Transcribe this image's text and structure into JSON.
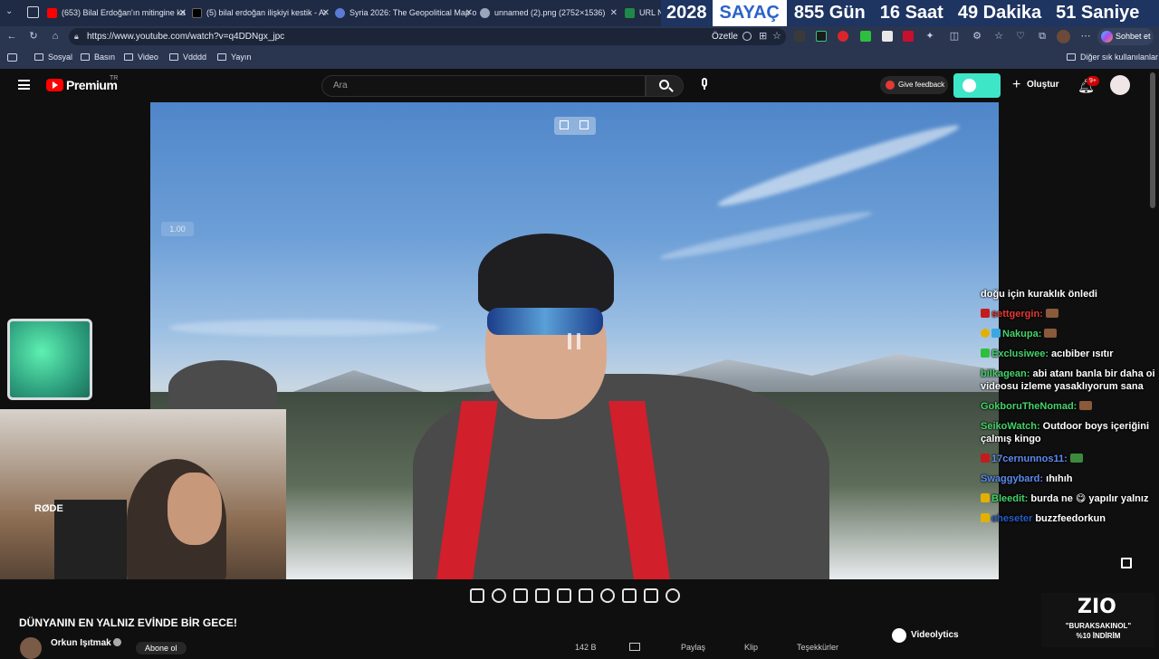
{
  "tabs": [
    {
      "title": "(653) Bilal Erdoğan'ın mitingine ka",
      "favicon_color": "#ff0000"
    },
    {
      "title": "(5) bilal erdoğan ilişkiyi kestik - Ar",
      "favicon_color": "#000000"
    },
    {
      "title": "Syria 2026: The Geopolitical Map o",
      "favicon_color": "#5a7bd6"
    },
    {
      "title": "unnamed (2).png (2752×1536)",
      "favicon_color": "#9aa6bd"
    },
    {
      "title": "URL N",
      "favicon_color": "#1f8a47"
    }
  ],
  "counter": {
    "year": "2028",
    "label": "SAYAÇ",
    "days": "855 Gün",
    "hours": "16 Saat",
    "minutes": "49 Dakika",
    "seconds": "51 Saniye"
  },
  "address": {
    "url": "https://www.youtube.com/watch?v=q4DDNgx_jpc",
    "summarize_label": "Özetle",
    "chat_label": "Sohbet et"
  },
  "bookmarks": {
    "items": [
      "Sosyal",
      "Basın",
      "Video",
      "Vdddd",
      "Yayın"
    ],
    "other": "Diğer sık kullanılanlar"
  },
  "youtube": {
    "logo": "Premium",
    "region": "TR",
    "search_placeholder": "Ara",
    "feedback_label": "Give feedback",
    "create_label": "Oluştur",
    "notif_count": "9+"
  },
  "video": {
    "speed": "1.00",
    "title": "DÜNYANIN EN YALNIZ EVİNDE BİR GECE!",
    "channel": "Orkun Işıtmak",
    "subscribe": "Abone ol",
    "likes": "142 B",
    "share": "Paylaş",
    "clip": "Klip",
    "thanks": "Teşekkürler"
  },
  "chat": [
    {
      "user": "",
      "text": "doğu için kuraklık önledi",
      "user_color": "#ffffff"
    },
    {
      "user": "settgergin:",
      "text": "",
      "user_color": "#e53935"
    },
    {
      "user": "Nakupa:",
      "text": "",
      "user_color": "#44d36b"
    },
    {
      "user": "Exclusiwee:",
      "text": "acıbiber ısıtır",
      "user_color": "#44d36b"
    },
    {
      "user": "bilkagean:",
      "text": "abi atanı banla bir daha oi videosu izleme yasaklıyorum sana",
      "user_color": "#44d36b"
    },
    {
      "user": "GokboruTheNomad:",
      "text": "",
      "user_color": "#44d36b"
    },
    {
      "user": "SeikoWatch:",
      "text": "Outdoor boys içeriğini çalmış kingo",
      "user_color": "#44d36b"
    },
    {
      "user": "17cernunnos11:",
      "text": "",
      "user_color": "#5b8df0"
    },
    {
      "user": "Swaggybard:",
      "text": "ıhıhıh",
      "user_color": "#5b8df0"
    },
    {
      "user": "Bleedit:",
      "text": "burda ne 😋 yapılır yalnız",
      "user_color": "#44d36b"
    },
    {
      "user": "cheseter",
      "text": "buzzfeedorkun",
      "user_color": "#2b5cc9"
    }
  ],
  "overlay": {
    "videolytics": "Videolytics",
    "promo_code": "\"BURAKSAKINOL\"",
    "promo_discount": "%10 İNDİRİM"
  }
}
